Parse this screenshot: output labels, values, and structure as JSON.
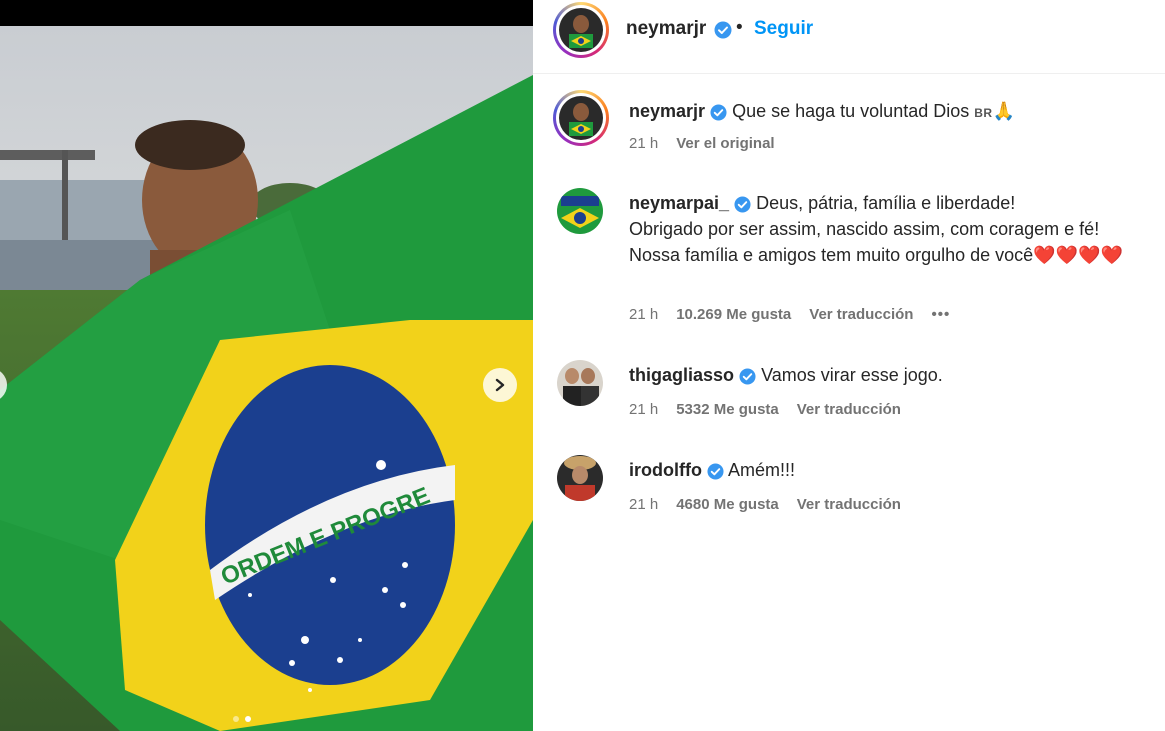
{
  "post": {
    "carousel": {
      "dot_count": 2,
      "active_index": 1
    }
  },
  "header": {
    "username": "neymarjr",
    "separator": "•",
    "follow_label": "Seguir"
  },
  "comments": [
    {
      "username": "neymarjr",
      "text": "Que se haga tu voluntad Dios",
      "flag_text": "BR",
      "emoji": "🙏",
      "time": "21 h",
      "action": "Ver el original"
    },
    {
      "username": "neymarpai_",
      "text_line1": "Deus, pátria, família e liberdade!",
      "text_line2": "Obrigado por ser assim, nascido assim, com coragem e fé!",
      "text_line3": "Nossa família e amigos tem muito orgulho de você",
      "hearts": "❤️❤️❤️❤️",
      "time": "21 h",
      "likes": "10.269 Me gusta",
      "action": "Ver traducción",
      "more": "•••"
    },
    {
      "username": "thigagliasso",
      "text": "Vamos virar esse jogo.",
      "time": "21 h",
      "likes": "5332 Me gusta",
      "action": "Ver traducción"
    },
    {
      "username": "irodolffo",
      "text": "Amém!!!",
      "time": "21 h",
      "likes": "4680 Me gusta",
      "action": "Ver traducción"
    }
  ],
  "colors": {
    "verified": "#3897f0",
    "follow": "#0095f6",
    "meta": "#737373",
    "heart": "#ed4956"
  },
  "icons": [
    "verified-badge-icon",
    "chevron-right-icon",
    "heart-icon"
  ]
}
